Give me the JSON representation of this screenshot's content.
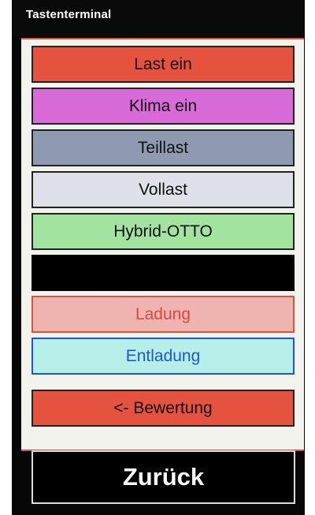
{
  "window": {
    "title": "Tastenterminal"
  },
  "buttons": [
    {
      "label": "Last ein",
      "color": "#e5533e"
    },
    {
      "label": "Klima ein",
      "color": "#d96bd9"
    },
    {
      "label": "Teillast",
      "color": "#8f9ab1"
    },
    {
      "label": "Vollast",
      "color": "#dfe1e8"
    },
    {
      "label": "Hybrid-OTTO",
      "color": "#a2e3a0"
    }
  ],
  "mode_buttons": [
    {
      "label": "Ladung",
      "color": "#f0b4b0",
      "text_color": "#d94a39",
      "border": "#d9533b"
    },
    {
      "label": "Entladung",
      "color": "#b6eee9",
      "text_color": "#1c58d6",
      "border": "#1c58d6"
    }
  ],
  "rating_button": {
    "label": "<- Bewertung",
    "color": "#e5533e"
  },
  "back_button": {
    "label": "Zurück"
  }
}
